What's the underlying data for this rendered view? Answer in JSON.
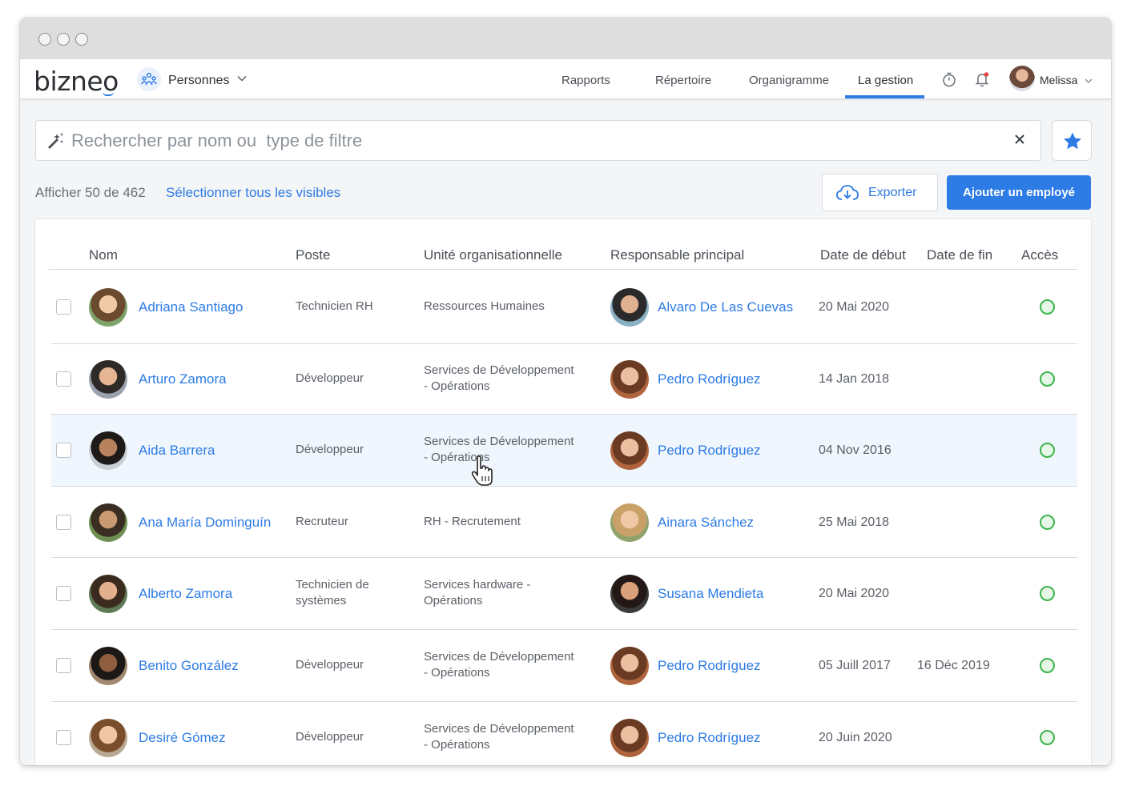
{
  "app": {
    "logo": "bizneo",
    "module": "Personnes",
    "nav": [
      "Rapports",
      "Répertoire",
      "Organigramme",
      "La gestion"
    ],
    "active_nav": "La gestion",
    "user": "Melissa"
  },
  "search": {
    "placeholder": "Rechercher par nom ou  type de filtre"
  },
  "toolbar": {
    "count": "Afficher 50 de 462",
    "select_all": "Sélectionner tous les visibles",
    "export": "Exporter",
    "add": "Ajouter un employé"
  },
  "table": {
    "columns": [
      "Nom",
      "Poste",
      "Unité organisationnelle",
      "Responsable principal",
      "Date de début",
      "Date de fin",
      "Accès"
    ],
    "rows": [
      {
        "name": "Adriana Santiago",
        "position": [
          "Technicien RH"
        ],
        "unit": [
          "Ressources Humaines"
        ],
        "manager": "Alvaro De Las Cuevas",
        "start": "20 Mai 2020",
        "end": "",
        "access": "active",
        "hover": false
      },
      {
        "name": "Arturo Zamora",
        "position": [
          "Développeur"
        ],
        "unit": [
          "Services de Développement",
          "- Opérations"
        ],
        "manager": "Pedro Rodríguez",
        "start": "14 Jan 2018",
        "end": "",
        "access": "active",
        "hover": false
      },
      {
        "name": "Aida Barrera",
        "position": [
          "Développeur"
        ],
        "unit": [
          "Services de Développement",
          "- Opérations"
        ],
        "manager": "Pedro Rodríguez",
        "start": "04 Nov 2016",
        "end": "",
        "access": "active",
        "hover": true
      },
      {
        "name": "Ana María Dominguín",
        "position": [
          "Recruteur"
        ],
        "unit": [
          "RH - Recrutement"
        ],
        "manager": "Ainara Sánchez",
        "start": "25 Mai 2018",
        "end": "",
        "access": "active",
        "hover": false
      },
      {
        "name": "Alberto Zamora",
        "position": [
          "Technicien de",
          "systèmes"
        ],
        "unit": [
          "Services hardware -",
          "Opérations"
        ],
        "manager": "Susana Mendieta",
        "start": "20 Mai 2020",
        "end": "",
        "access": "active",
        "hover": false
      },
      {
        "name": "Benito González",
        "position": [
          "Développeur"
        ],
        "unit": [
          "Services de Développement",
          "- Opérations"
        ],
        "manager": "Pedro Rodríguez",
        "start": "05 Juill 2017",
        "end": "16 Déc 2019",
        "access": "active",
        "hover": false
      },
      {
        "name": "Desiré Gómez",
        "position": [
          "Développeur"
        ],
        "unit": [
          "Services de Développement",
          "- Opérations"
        ],
        "manager": "Pedro Rodríguez",
        "start": "20 Juin 2020",
        "end": "",
        "access": "active",
        "hover": false
      }
    ]
  },
  "colors": {
    "accent": "#2d7be5",
    "access_active": "#3bb54a",
    "hover_row": "#f0f6fd"
  }
}
